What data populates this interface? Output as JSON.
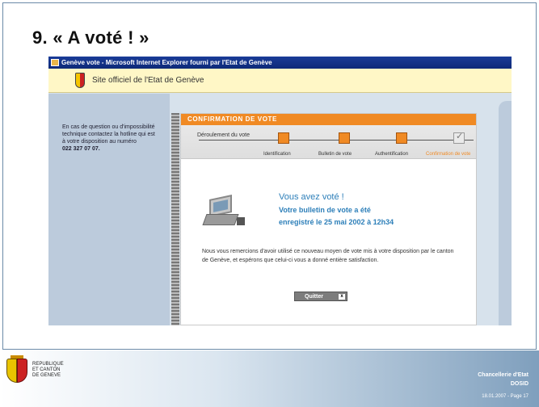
{
  "slide": {
    "title": "9. « A voté ! »"
  },
  "browser": {
    "title_bar": "Genève vote - Microsoft Internet Explorer fourni par l'Etat de Genève"
  },
  "site": {
    "banner_text": "Site officiel de l'Etat de Genève"
  },
  "help_panel": {
    "text": "En cas de question ou d'impossibilité technique contactez la hotline qui est à votre disposition au numéro",
    "phone": "022 327 07 07."
  },
  "confirmation": {
    "header": "CONFIRMATION DE VOTE",
    "progress_label": "Déroulement du vote",
    "steps": [
      {
        "label": "Identification",
        "state": "done"
      },
      {
        "label": "Bulletin de vote",
        "state": "done"
      },
      {
        "label": "Authentification",
        "state": "done"
      },
      {
        "label": "Confirmation de vote",
        "state": "current"
      }
    ],
    "voted_title": "Vous avez voté !",
    "voted_line1": "Votre bulletin de vote a été",
    "voted_line2": "enregistré le 25 mai 2002 à 12h34",
    "thanks_text": "Nous vous remercions d'avoir utilisé ce nouveau moyen de vote mis à votre disposition par le canton de Genève, et espérons que celui-ci vous a donné entière satisfaction.",
    "quit_label": "Quitter",
    "quit_x": "x"
  },
  "footer": {
    "org_line1": "REPUBLIQUE",
    "org_line2": "ET CANTON",
    "org_line3": "DE GENEVE",
    "dept_line1": "Chancellerie d'Etat",
    "dept_line2": "DOSID",
    "page_info": "18.01.2007 - Page 17"
  },
  "colors": {
    "accent_orange": "#f08a24",
    "voted_blue": "#2d7fb9"
  }
}
